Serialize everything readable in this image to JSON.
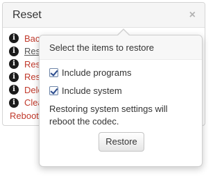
{
  "panel": {
    "title": "Reset",
    "close_glyph": "×",
    "rows": [
      {
        "icon": "info-icon",
        "label": "Bac"
      },
      {
        "icon": "info-icon",
        "label": "Res"
      },
      {
        "icon": "info-icon",
        "label": "Res"
      },
      {
        "icon": "info-icon",
        "label": "Res"
      },
      {
        "icon": "info-icon",
        "label": "Dele"
      },
      {
        "icon": "info-icon",
        "label": "Clea"
      }
    ],
    "reboot_label": "Reboot"
  },
  "popover": {
    "title": "Select the items to restore",
    "options": [
      {
        "label": "Include programs",
        "checked": true
      },
      {
        "label": "Include system",
        "checked": true
      }
    ],
    "note": "Restoring system settings will reboot the codec.",
    "button_label": "Restore"
  },
  "colors": {
    "link": "#c0392b",
    "header_bg": "#f5f5f5"
  }
}
